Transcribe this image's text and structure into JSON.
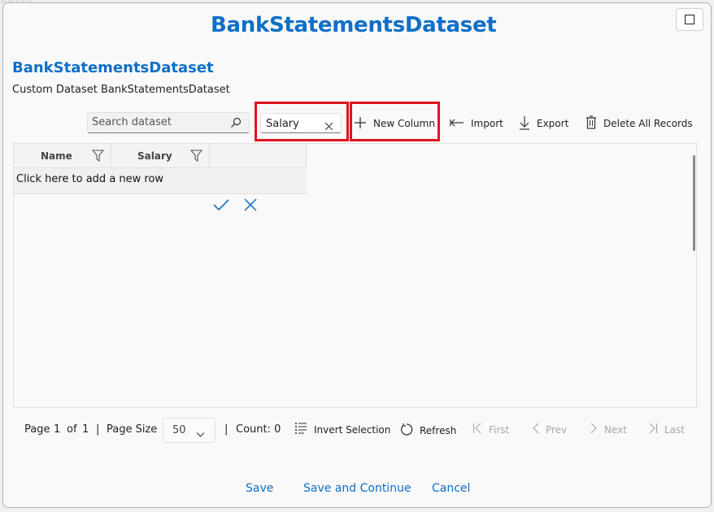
{
  "dialog": {
    "title": "BankStatementsDataset",
    "maximize_icon": "maximize-icon"
  },
  "dataset": {
    "name": "BankStatementsDataset",
    "description": "Custom Dataset BankStatementsDataset"
  },
  "toolbar": {
    "search_placeholder": "Search dataset",
    "column_input_value": "Salary",
    "new_column_label": "New Column",
    "import_label": "Import",
    "export_label": "Export",
    "delete_all_label": "Delete All Records"
  },
  "grid": {
    "columns": [
      {
        "label": "Name",
        "icon": "filter-icon"
      },
      {
        "label": "Salary",
        "icon": "filter-icon"
      }
    ],
    "add_row_text": "Click here to add a new row"
  },
  "pager": {
    "page_label": "Page",
    "page_current": "1",
    "of_label": "of",
    "page_total": "1",
    "page_size_label": "Page Size",
    "page_size_value": "50",
    "count_text": "Count: 0",
    "invert_selection_label": "Invert Selection",
    "refresh_label": "Refresh",
    "first_label": "First",
    "prev_label": "Prev",
    "next_label": "Next",
    "last_label": "Last"
  },
  "footer": {
    "save_label": "Save",
    "save_continue_label": "Save and Continue",
    "cancel_label": "Cancel"
  },
  "colors": {
    "accent": "#0f6fc6",
    "highlight_border": "#e0121c"
  }
}
